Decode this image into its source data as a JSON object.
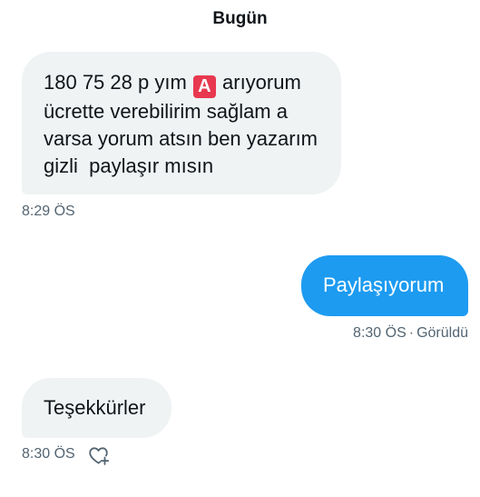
{
  "conversation": {
    "day_header": "Bugün",
    "messages": [
      {
        "direction": "incoming",
        "lines": [
          "180 75 28 p yım ",
          "ücrette verebilirim sağlam a",
          "varsa yorum atsın ben yazarım",
          "gizli  paylaşır mısın"
        ],
        "line1_emoji": "A",
        "line1_after": " arıyorum",
        "time": "8:29 ÖS"
      },
      {
        "direction": "outgoing",
        "text": "Paylaşıyorum",
        "time": "8:30 ÖS",
        "status": "Görüldü"
      },
      {
        "direction": "incoming",
        "text": "Teşekkürler",
        "time": "8:30 ÖS",
        "reaction_icon": "heart-plus-icon"
      }
    ]
  },
  "colors": {
    "incoming_bubble": "#eff3f4",
    "outgoing_bubble": "#1d9bf0",
    "meta_text": "#536471",
    "emoji_red": "#e8384f"
  }
}
